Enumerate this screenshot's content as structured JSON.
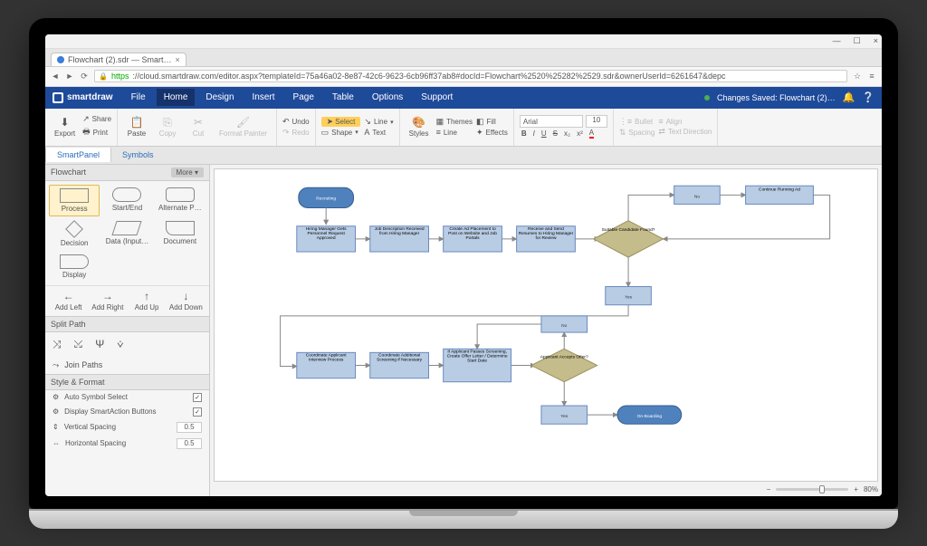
{
  "window": {
    "min": "—",
    "max": "☐",
    "close": "×"
  },
  "tab": {
    "title": "Flowchart (2).sdr — Smart…"
  },
  "address": {
    "secure": "https",
    "url": "://cloud.smartdraw.com/editor.aspx?templateId=75a46a02-8e87-42c6-9623-6cb96ff37ab8#docId=Flowchart%2520%25282%2529.sdr&ownerUserId=6261647&depc"
  },
  "brand": "smartdraw",
  "menus": {
    "file": "File",
    "home": "Home",
    "design": "Design",
    "insert": "Insert",
    "page": "Page",
    "table": "Table",
    "options": "Options",
    "support": "Support"
  },
  "status": {
    "saved": "Changes Saved: Flowchart (2)…"
  },
  "ribbon": {
    "export": "Export",
    "share": "Share",
    "print": "Print",
    "paste": "Paste",
    "copy": "Copy",
    "cut": "Cut",
    "format_painter": "Format Painter",
    "undo": "Undo",
    "redo": "Redo",
    "select": "Select",
    "shape": "Shape",
    "line": "Line",
    "text": "Text",
    "styles": "Styles",
    "themes": "Themes",
    "line2": "Line",
    "fill": "Fill",
    "effects": "Effects",
    "font": "Arial",
    "size": "10",
    "bold": "B",
    "italic": "I",
    "underline": "U",
    "strike": "S",
    "sub": "x₂",
    "sup": "x²",
    "fontcolor": "A",
    "bullet": "Bullet",
    "spacing": "Spacing",
    "align": "Align",
    "direction": "Text Direction"
  },
  "panel_tabs": {
    "smart": "SmartPanel",
    "symbols": "Symbols"
  },
  "shapes_header": "Flowchart",
  "more": "More ▾",
  "shapes": {
    "process": "Process",
    "startend": "Start/End",
    "alternate": "Alternate P…",
    "decision": "Decision",
    "datainput": "Data (Input…",
    "document": "Document",
    "display": "Display"
  },
  "nav": {
    "left": "Add Left",
    "right": "Add Right",
    "up": "Add Up",
    "down": "Add Down"
  },
  "split_header": "Split Path",
  "join": "Join Paths",
  "style_header": "Style & Format",
  "style": {
    "auto": "Auto Symbol Select",
    "smartaction": "Display SmartAction Buttons",
    "vspace": "Vertical Spacing",
    "hspace": "Horizontal Spacing",
    "val": "0.5"
  },
  "zoom": "80%",
  "flow": {
    "recruiting": "Recruiting",
    "b1": "Hiring Manager Gets Personnel Request Approved",
    "b2": "Job Description Received from Hiring Manager",
    "b3": "Create Ad Placement to Post on Website and Job Portals",
    "b4": "Receive and Send Resumes to Hiring Manager for Review",
    "d1": "Suitable Candidate Found?",
    "no": "No",
    "yes": "Yes",
    "c1": "Continue Running Ad",
    "b5": "Coordinate Applicant Interview Process",
    "b6": "Coordinate Additional Screening if Necessary",
    "b7": "If Applicant Passes Screening, Create Offer Letter / Determine Start Date",
    "d2": "Applicant Accepts Offer?",
    "ob": "On-Boarding"
  }
}
